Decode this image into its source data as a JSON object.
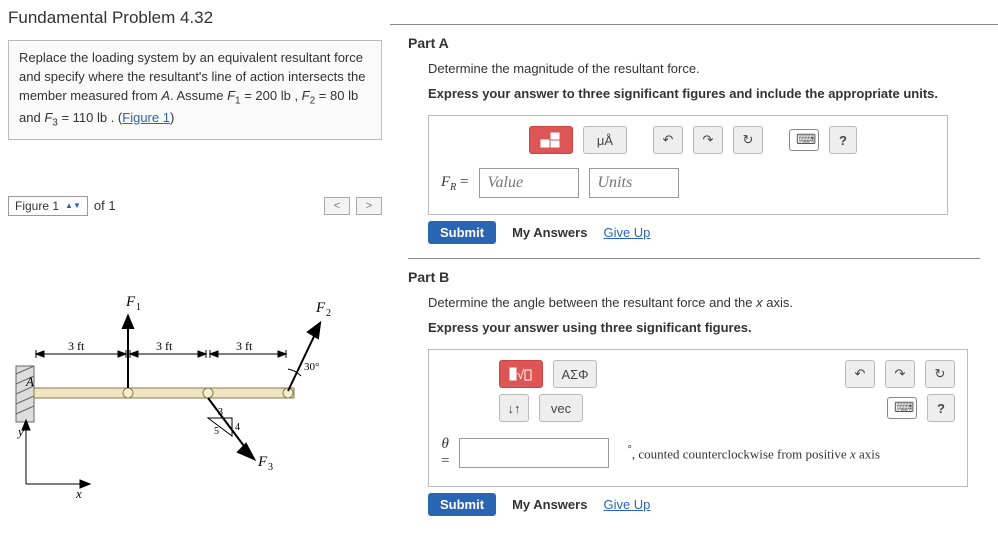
{
  "title": "Fundamental Problem 4.32",
  "problem_html": "Replace the loading system by an equivalent resultant force and specify where the resultant's line of action intersects the member measured from A. Assume F₁ = 200 lb , F₂ = 80 lb and F₃ = 110 lb . (",
  "figure_link": "Figure 1",
  "figure_selector": {
    "label": "Figure 1",
    "of": "of 1"
  },
  "fig": {
    "F1": "F₁",
    "F2": "F₂",
    "F3": "F₃",
    "d1": "3 ft",
    "d2": "3 ft",
    "d3": "3 ft",
    "ang": "30°",
    "ratio_h": "5",
    "ratio_v": "4",
    "ratio_b": "3",
    "A": "A",
    "x": "x",
    "y": "y"
  },
  "partA": {
    "title": "Part A",
    "sub": "Determine the magnitude of the resultant force.",
    "instr": "Express your answer to three significant figures and include the appropriate units.",
    "toolbar": {
      "templ": "▯▯",
      "mu": "μÅ",
      "help": "?"
    },
    "eq_lhs": "F_R =",
    "value_ph": "Value",
    "units_ph": "Units"
  },
  "partB": {
    "title": "Part B",
    "sub_prefix": "Determine the angle between the resultant force and the ",
    "sub_var": "x",
    "sub_suffix": " axis.",
    "instr": "Express your answer using three significant figures.",
    "toolbar": {
      "sqrt": "√▯",
      "greek": "ΑΣΦ",
      "arrows": "↓↑",
      "vec": "vec",
      "help": "?"
    },
    "lhs1": "θ",
    "lhs2": "=",
    "after_deg": "°",
    "after_txt1": ", counted counterclockwise from positive ",
    "after_var": "x",
    "after_txt2": " axis"
  },
  "submit": {
    "submit": "Submit",
    "my": "My Answers",
    "give": "Give Up"
  }
}
